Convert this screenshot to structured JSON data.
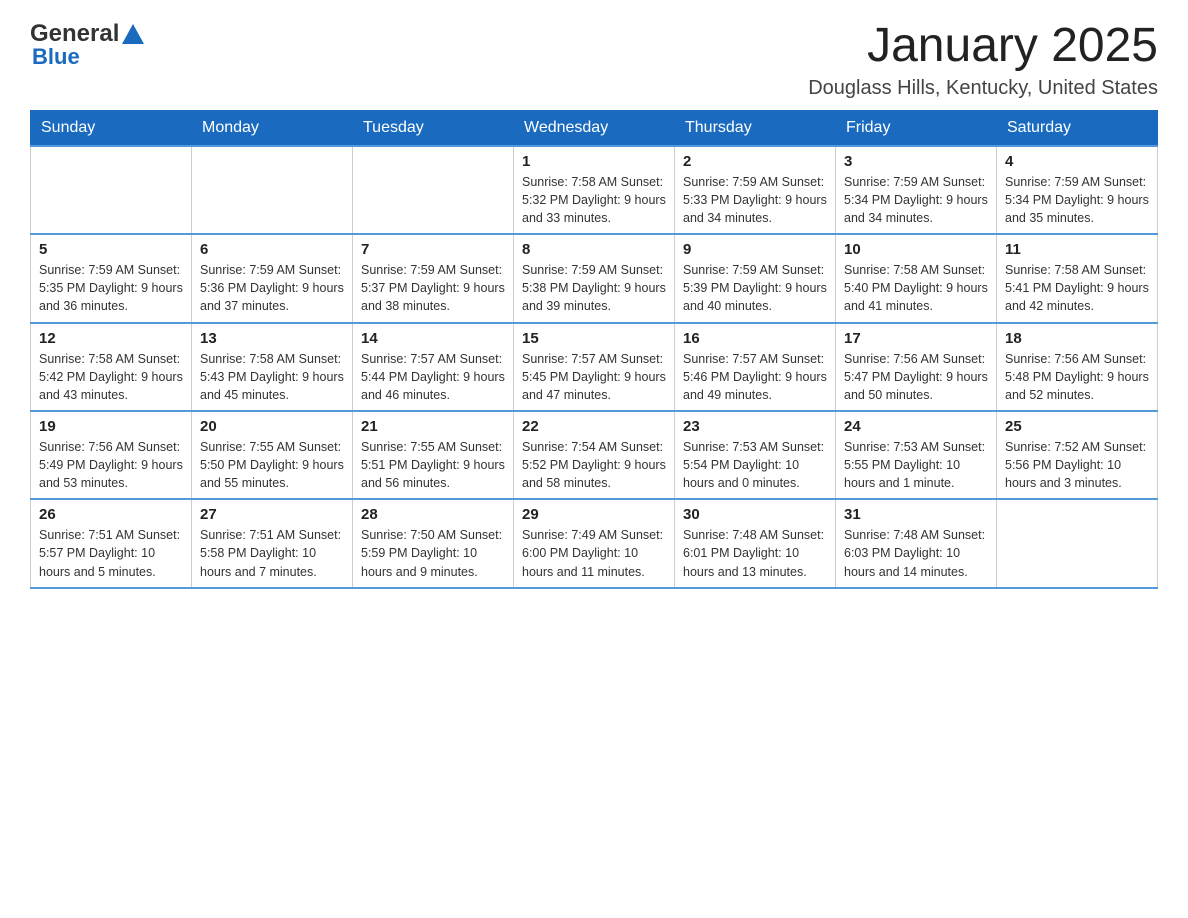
{
  "header": {
    "logo_general": "General",
    "logo_triangle": "▶",
    "logo_blue": "Blue",
    "month_title": "January 2025",
    "location": "Douglass Hills, Kentucky, United States"
  },
  "days_of_week": [
    "Sunday",
    "Monday",
    "Tuesday",
    "Wednesday",
    "Thursday",
    "Friday",
    "Saturday"
  ],
  "weeks": [
    [
      {
        "day": "",
        "info": ""
      },
      {
        "day": "",
        "info": ""
      },
      {
        "day": "",
        "info": ""
      },
      {
        "day": "1",
        "info": "Sunrise: 7:58 AM\nSunset: 5:32 PM\nDaylight: 9 hours\nand 33 minutes."
      },
      {
        "day": "2",
        "info": "Sunrise: 7:59 AM\nSunset: 5:33 PM\nDaylight: 9 hours\nand 34 minutes."
      },
      {
        "day": "3",
        "info": "Sunrise: 7:59 AM\nSunset: 5:34 PM\nDaylight: 9 hours\nand 34 minutes."
      },
      {
        "day": "4",
        "info": "Sunrise: 7:59 AM\nSunset: 5:34 PM\nDaylight: 9 hours\nand 35 minutes."
      }
    ],
    [
      {
        "day": "5",
        "info": "Sunrise: 7:59 AM\nSunset: 5:35 PM\nDaylight: 9 hours\nand 36 minutes."
      },
      {
        "day": "6",
        "info": "Sunrise: 7:59 AM\nSunset: 5:36 PM\nDaylight: 9 hours\nand 37 minutes."
      },
      {
        "day": "7",
        "info": "Sunrise: 7:59 AM\nSunset: 5:37 PM\nDaylight: 9 hours\nand 38 minutes."
      },
      {
        "day": "8",
        "info": "Sunrise: 7:59 AM\nSunset: 5:38 PM\nDaylight: 9 hours\nand 39 minutes."
      },
      {
        "day": "9",
        "info": "Sunrise: 7:59 AM\nSunset: 5:39 PM\nDaylight: 9 hours\nand 40 minutes."
      },
      {
        "day": "10",
        "info": "Sunrise: 7:58 AM\nSunset: 5:40 PM\nDaylight: 9 hours\nand 41 minutes."
      },
      {
        "day": "11",
        "info": "Sunrise: 7:58 AM\nSunset: 5:41 PM\nDaylight: 9 hours\nand 42 minutes."
      }
    ],
    [
      {
        "day": "12",
        "info": "Sunrise: 7:58 AM\nSunset: 5:42 PM\nDaylight: 9 hours\nand 43 minutes."
      },
      {
        "day": "13",
        "info": "Sunrise: 7:58 AM\nSunset: 5:43 PM\nDaylight: 9 hours\nand 45 minutes."
      },
      {
        "day": "14",
        "info": "Sunrise: 7:57 AM\nSunset: 5:44 PM\nDaylight: 9 hours\nand 46 minutes."
      },
      {
        "day": "15",
        "info": "Sunrise: 7:57 AM\nSunset: 5:45 PM\nDaylight: 9 hours\nand 47 minutes."
      },
      {
        "day": "16",
        "info": "Sunrise: 7:57 AM\nSunset: 5:46 PM\nDaylight: 9 hours\nand 49 minutes."
      },
      {
        "day": "17",
        "info": "Sunrise: 7:56 AM\nSunset: 5:47 PM\nDaylight: 9 hours\nand 50 minutes."
      },
      {
        "day": "18",
        "info": "Sunrise: 7:56 AM\nSunset: 5:48 PM\nDaylight: 9 hours\nand 52 minutes."
      }
    ],
    [
      {
        "day": "19",
        "info": "Sunrise: 7:56 AM\nSunset: 5:49 PM\nDaylight: 9 hours\nand 53 minutes."
      },
      {
        "day": "20",
        "info": "Sunrise: 7:55 AM\nSunset: 5:50 PM\nDaylight: 9 hours\nand 55 minutes."
      },
      {
        "day": "21",
        "info": "Sunrise: 7:55 AM\nSunset: 5:51 PM\nDaylight: 9 hours\nand 56 minutes."
      },
      {
        "day": "22",
        "info": "Sunrise: 7:54 AM\nSunset: 5:52 PM\nDaylight: 9 hours\nand 58 minutes."
      },
      {
        "day": "23",
        "info": "Sunrise: 7:53 AM\nSunset: 5:54 PM\nDaylight: 10 hours\nand 0 minutes."
      },
      {
        "day": "24",
        "info": "Sunrise: 7:53 AM\nSunset: 5:55 PM\nDaylight: 10 hours\nand 1 minute."
      },
      {
        "day": "25",
        "info": "Sunrise: 7:52 AM\nSunset: 5:56 PM\nDaylight: 10 hours\nand 3 minutes."
      }
    ],
    [
      {
        "day": "26",
        "info": "Sunrise: 7:51 AM\nSunset: 5:57 PM\nDaylight: 10 hours\nand 5 minutes."
      },
      {
        "day": "27",
        "info": "Sunrise: 7:51 AM\nSunset: 5:58 PM\nDaylight: 10 hours\nand 7 minutes."
      },
      {
        "day": "28",
        "info": "Sunrise: 7:50 AM\nSunset: 5:59 PM\nDaylight: 10 hours\nand 9 minutes."
      },
      {
        "day": "29",
        "info": "Sunrise: 7:49 AM\nSunset: 6:00 PM\nDaylight: 10 hours\nand 11 minutes."
      },
      {
        "day": "30",
        "info": "Sunrise: 7:48 AM\nSunset: 6:01 PM\nDaylight: 10 hours\nand 13 minutes."
      },
      {
        "day": "31",
        "info": "Sunrise: 7:48 AM\nSunset: 6:03 PM\nDaylight: 10 hours\nand 14 minutes."
      },
      {
        "day": "",
        "info": ""
      }
    ]
  ]
}
